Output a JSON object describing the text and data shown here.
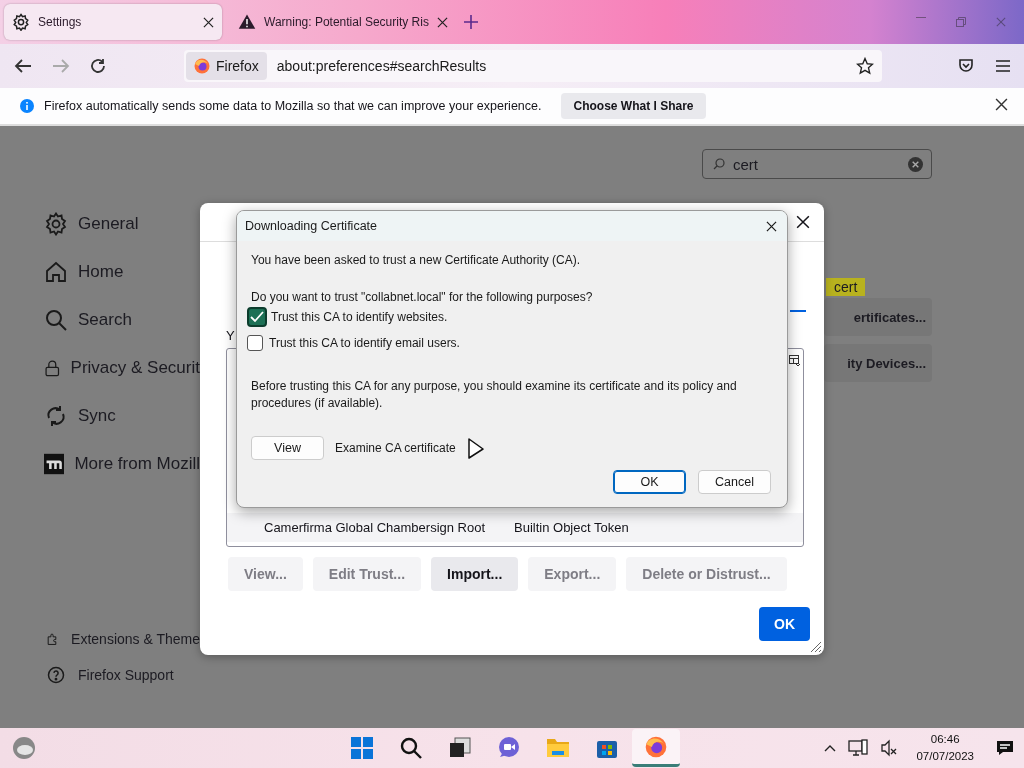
{
  "browser_tabs": [
    {
      "label": "Settings",
      "kind": "settings",
      "selected": true
    },
    {
      "label": "Warning: Potential Security Ris",
      "kind": "warning",
      "selected": false
    }
  ],
  "toolbar": {
    "identity_label": "Firefox",
    "url": "about:preferences#searchResults"
  },
  "notification": {
    "message": "Firefox automatically sends some data to Mozilla so that we can improve your experience.",
    "button": "Choose What I Share"
  },
  "preferences": {
    "search": {
      "value": "cert"
    },
    "sidebar": {
      "items": [
        {
          "label": "General",
          "kind": "general"
        },
        {
          "label": "Home",
          "kind": "home"
        },
        {
          "label": "Search",
          "kind": "search"
        },
        {
          "label": "Privacy & Securit",
          "kind": "privacy"
        },
        {
          "label": "Sync",
          "kind": "sync"
        },
        {
          "label": "More from Mozill",
          "kind": "mozilla"
        }
      ],
      "footer_links": [
        {
          "label": "Extensions & Theme",
          "kind": "extensions"
        },
        {
          "label": "Firefox Support",
          "kind": "support"
        }
      ]
    },
    "search_highlight": "cert",
    "section_buttons": [
      "ertificates...",
      "ity Devices..."
    ]
  },
  "certificate_manager": {
    "intro": "Y",
    "rows": [
      {
        "name": "Camerfirma Global Chambersign Root",
        "device": "Builtin Object Token"
      }
    ],
    "buttons": [
      {
        "label": "View...",
        "disabled": true
      },
      {
        "label": "Edit Trust...",
        "disabled": true
      },
      {
        "label": "Import...",
        "disabled": false
      },
      {
        "label": "Export...",
        "disabled": true
      },
      {
        "label": "Delete or Distrust...",
        "disabled": true
      }
    ],
    "ok": "OK"
  },
  "download_dialog": {
    "title": "Downloading Certificate",
    "intro": "You have been asked to trust a new Certificate Authority (CA).",
    "question": "Do you want to trust \"collabnet.local\" for the following purposes?",
    "options": [
      {
        "label": "Trust this CA to identify websites.",
        "checked": true
      },
      {
        "label": "Trust this CA to identify email users.",
        "checked": false
      }
    ],
    "warning": "Before trusting this CA for any purpose, you should examine its certificate and its policy and procedures (if available).",
    "view_button": "View",
    "view_caption": "Examine CA certificate",
    "buttons": [
      {
        "label": "OK",
        "focused": true
      },
      {
        "label": "Cancel",
        "focused": false
      }
    ]
  },
  "taskbar": {
    "apps": [
      {
        "kind": "start",
        "selected": false
      },
      {
        "kind": "search",
        "selected": false
      },
      {
        "kind": "taskview",
        "selected": false
      },
      {
        "kind": "chat",
        "selected": false
      },
      {
        "kind": "files",
        "selected": false
      },
      {
        "kind": "store",
        "selected": false
      },
      {
        "kind": "firefox",
        "selected": true
      }
    ],
    "time": "06:46",
    "date": "07/07/2023"
  }
}
